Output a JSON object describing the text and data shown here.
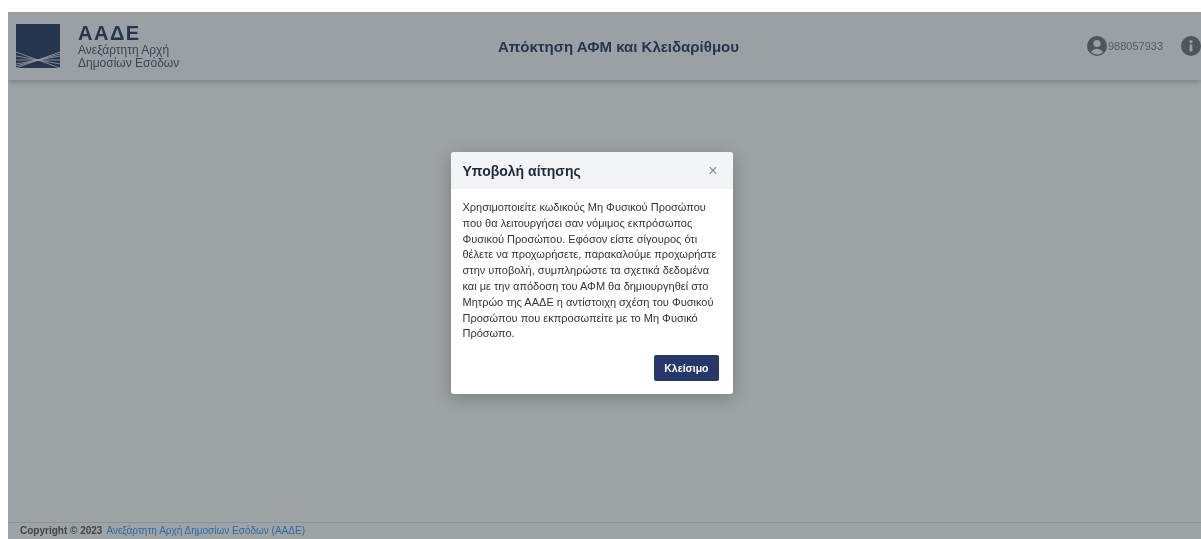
{
  "header": {
    "logo_abbr": "ΑΑΔΕ",
    "logo_line1": "Ανεξάρτητη Αρχή",
    "logo_line2": "Δημοσίων Εσόδων",
    "title": "Απόκτηση ΑΦΜ και Κλειδαρίθμου",
    "user": "988057933"
  },
  "modal": {
    "title": "Υποβολή αίτησης",
    "close": "×",
    "body": "Χρησιμοποιείτε κωδικούς Μη Φυσικού Προσώπου που θα λειτουργήσει σαν νόμιμος εκπρόσωπος Φυσικού Προσώπου. Εφόσον είστε σίγουρος ότι θέλετε να προχωρήσετε, παρακαλούμε προχωρήστε στην υποβολή, συμπληρώστε τα σχετικά δεδομένα και με την απόδοση του ΑΦΜ θα δημιουργηθεί στο Μητρώο της ΑΑΔΕ η αντίστοιχη σχέση του Φυσικού Προσώπου που εκπροσωπείτε με το Μη Φυσικό Πρόσωπο.",
    "button": "Κλείσιμο"
  },
  "footer": {
    "copyright": "Copyright © 2023",
    "link": "Ανεξάρτητη Αρχή Δημοσίων Εσόδων (ΑΑΔΕ)"
  }
}
